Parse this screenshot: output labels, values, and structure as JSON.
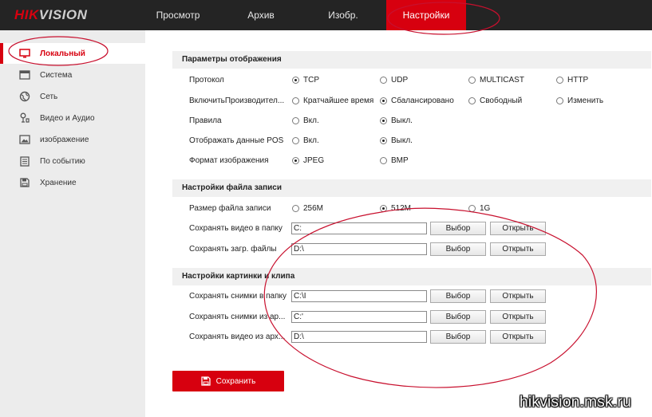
{
  "brand": {
    "part1": "HIK",
    "part2": "VISION"
  },
  "nav": [
    {
      "label": "Просмотр"
    },
    {
      "label": "Архив"
    },
    {
      "label": "Изобр."
    },
    {
      "label": "Настройки"
    }
  ],
  "sidebar": [
    {
      "label": "Локальный",
      "icon": "monitor-icon"
    },
    {
      "label": "Система",
      "icon": "window-icon"
    },
    {
      "label": "Сеть",
      "icon": "globe-icon"
    },
    {
      "label": "Видео и Аудио",
      "icon": "mic-icon"
    },
    {
      "label": "изображение",
      "icon": "picture-icon"
    },
    {
      "label": "По событию",
      "icon": "calendar-icon"
    },
    {
      "label": "Хранение",
      "icon": "storage-icon"
    }
  ],
  "display": {
    "title": "Параметры отображения",
    "protocol": {
      "label": "Протокол",
      "options": [
        "TCP",
        "UDP",
        "MULTICAST",
        "HTTP"
      ],
      "selected": "TCP"
    },
    "performance": {
      "label": "ВключитьПроизводител...",
      "options": [
        "Кратчайшее время",
        "Сбалансировано",
        "Свободный",
        "Изменить"
      ],
      "selected": "Сбалансировано"
    },
    "rules": {
      "label": "Правила",
      "options": [
        "Вкл.",
        "Выкл."
      ],
      "selected": "Выкл."
    },
    "pos": {
      "label": "Отображать данные POS",
      "options": [
        "Вкл.",
        "Выкл."
      ],
      "selected": "Выкл."
    },
    "format": {
      "label": "Формат изображения",
      "options": [
        "JPEG",
        "BMP"
      ],
      "selected": "JPEG"
    }
  },
  "record": {
    "title": "Настройки файла записи",
    "size": {
      "label": "Размер файла записи",
      "options": [
        "256M",
        "512M",
        "1G"
      ],
      "selected": "512M"
    },
    "video_folder": {
      "label": "Сохранять видео в папку",
      "value": "C:"
    },
    "download_folder": {
      "label": "Сохранять загр. файлы",
      "value": "D:\\"
    }
  },
  "snapshot": {
    "title": "Настройки картинки и клипа",
    "snap_folder": {
      "label": "Сохранять снимки в папку",
      "value": "C:\\I"
    },
    "snap_play": {
      "label": "Сохранять снимки из ар...",
      "value": "C:'"
    },
    "clip_play": {
      "label": "Сохранять видео из арх...",
      "value": "D:\\"
    }
  },
  "buttons": {
    "browse": "Выбор",
    "open": "Открыть",
    "save": "Сохранить"
  },
  "watermark": "hikvision.msk.ru",
  "colors": {
    "accent": "#d7000f",
    "topbar": "#242424",
    "sidebar": "#ececec",
    "annotation": "#c8102e"
  }
}
